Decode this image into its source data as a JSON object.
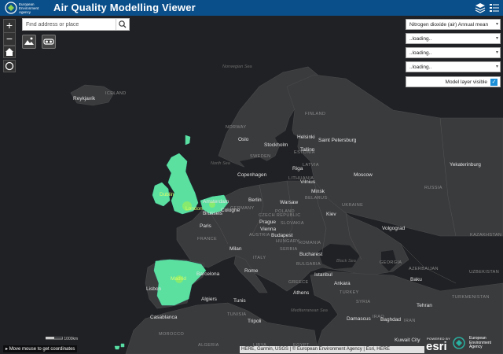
{
  "header": {
    "logo_text": "European Environment Agency",
    "title": "Air Quality Modelling Viewer",
    "icons": [
      "layers-icon",
      "legend-list-icon"
    ]
  },
  "search": {
    "placeholder": "Find address or place",
    "icon": "search-icon"
  },
  "controls": {
    "zoom_in": "+",
    "zoom_out": "−",
    "home_icon": "home-icon",
    "locate_icon": "locate-icon"
  },
  "tools": [
    "basemap-icon",
    "compare-icon"
  ],
  "panel": {
    "selects": [
      "Nitrogen dioxide (air) Annual mean",
      "..loading..",
      "..loading..",
      "..loading.."
    ],
    "toggle_label": "Model layer visible",
    "toggle_checked": true
  },
  "map": {
    "cities": [
      [
        "Reykjavík",
        93,
        126
      ],
      [
        "Oslo",
        303,
        178
      ],
      [
        "Stockholm",
        336,
        185
      ],
      [
        "Helsinki",
        378,
        175
      ],
      [
        "Saint Petersburg",
        405,
        179
      ],
      [
        "Tallinn",
        382,
        191
      ],
      [
        "Riga",
        372,
        215
      ],
      [
        "Vilnius",
        382,
        232
      ],
      [
        "Moscow",
        450,
        223
      ],
      [
        "Minsk",
        396,
        244
      ],
      [
        "Copenhagen",
        302,
        223
      ],
      [
        "Berlin",
        316,
        255
      ],
      [
        "Amsterdam",
        258,
        257
      ],
      [
        "Warsaw",
        356,
        258
      ],
      [
        "Yekaterinburg",
        572,
        210
      ],
      [
        "Kiev",
        415,
        273
      ],
      [
        "Prague",
        330,
        283
      ],
      [
        "Vienna",
        331,
        292
      ],
      [
        "Budapest",
        345,
        300
      ],
      [
        "Paris",
        254,
        288
      ],
      [
        "Brussels",
        258,
        272
      ],
      [
        "Cologne",
        281,
        268
      ],
      [
        "Milan",
        292,
        317
      ],
      [
        "Bucharest",
        381,
        324
      ],
      [
        "Volgograd",
        486,
        291
      ],
      [
        "Rome",
        311,
        345
      ],
      [
        "Istanbul",
        400,
        350
      ],
      [
        "Ankara",
        425,
        361
      ],
      [
        "Athens",
        373,
        373
      ],
      [
        "Baku",
        522,
        356
      ],
      [
        "Tehran",
        530,
        389
      ],
      [
        "Lisbon",
        186,
        368
      ],
      [
        "Algiers",
        256,
        381
      ],
      [
        "Tunis",
        297,
        383
      ],
      [
        "Tripoli",
        315,
        409
      ],
      [
        "Casablanca",
        191,
        404
      ],
      [
        "Damascus",
        441,
        406
      ],
      [
        "Baghdad",
        484,
        407
      ],
      [
        "Kuwait City",
        502,
        433
      ],
      [
        "Barcelona",
        250,
        349
      ]
    ],
    "highlight_cities": [
      [
        "London",
        236,
        266
      ],
      [
        "Madrid",
        217,
        355
      ],
      [
        "Dublin",
        203,
        248
      ]
    ],
    "countries": [
      [
        "ICELAND",
        134,
        120
      ],
      [
        "FINLAND",
        388,
        146
      ],
      [
        "NORWAY",
        287,
        163
      ],
      [
        "SWEDEN",
        318,
        200
      ],
      [
        "ESTONIA",
        374,
        195
      ],
      [
        "LATVIA",
        385,
        211
      ],
      [
        "LITHUANIA",
        367,
        228
      ],
      [
        "BELARUS",
        388,
        253
      ],
      [
        "UKRAINE",
        435,
        262
      ],
      [
        "POLAND",
        350,
        270
      ],
      [
        "GERMANY",
        293,
        266
      ],
      [
        "CZECH REPUBLIC",
        329,
        275
      ],
      [
        "AUSTRIA",
        317,
        300
      ],
      [
        "SLOVAKIA",
        357,
        285
      ],
      [
        "HUNGARY",
        351,
        308
      ],
      [
        "FRANCE",
        251,
        305
      ],
      [
        "ROMANIA",
        380,
        310
      ],
      [
        "SERBIA",
        356,
        318
      ],
      [
        "BULGARIA",
        377,
        337
      ],
      [
        "ITALY",
        322,
        329
      ],
      [
        "GREECE",
        367,
        360
      ],
      [
        "TURKEY",
        432,
        373
      ],
      [
        "SYRIA",
        453,
        385
      ],
      [
        "IRAQ",
        474,
        404
      ],
      [
        "IRAN",
        514,
        409
      ],
      [
        "AZERBAIJAN",
        520,
        343
      ],
      [
        "UZBEKISTAN",
        597,
        347
      ],
      [
        "KAZAKHSTAN",
        598,
        300
      ],
      [
        "TUNISIA",
        289,
        401
      ],
      [
        "MOROCCO",
        202,
        426
      ],
      [
        "ALGERIA",
        252,
        440
      ],
      [
        "LIBYA",
        322,
        440
      ],
      [
        "EGYPT",
        373,
        440
      ],
      [
        "TURKMENISTAN",
        575,
        379
      ],
      [
        "GEORGIA",
        483,
        335
      ],
      [
        "RUSSIA",
        540,
        240
      ]
    ],
    "seas": [
      [
        "Norwegian Sea",
        283,
        86
      ],
      [
        "North Sea",
        268,
        209
      ],
      [
        "Black Sea",
        428,
        333
      ],
      [
        "Mediterranean Sea",
        370,
        396
      ]
    ]
  },
  "footer": {
    "coords_text": "Move mouse to get coordinates",
    "attribution": "HERE, Garmin, USGS | © European Environment Agency | Esri, HERE",
    "esri_powered": "POWERED BY",
    "esri_brand": "esri",
    "eea_text": "European Environment Agency",
    "scale_text": "1000km"
  }
}
